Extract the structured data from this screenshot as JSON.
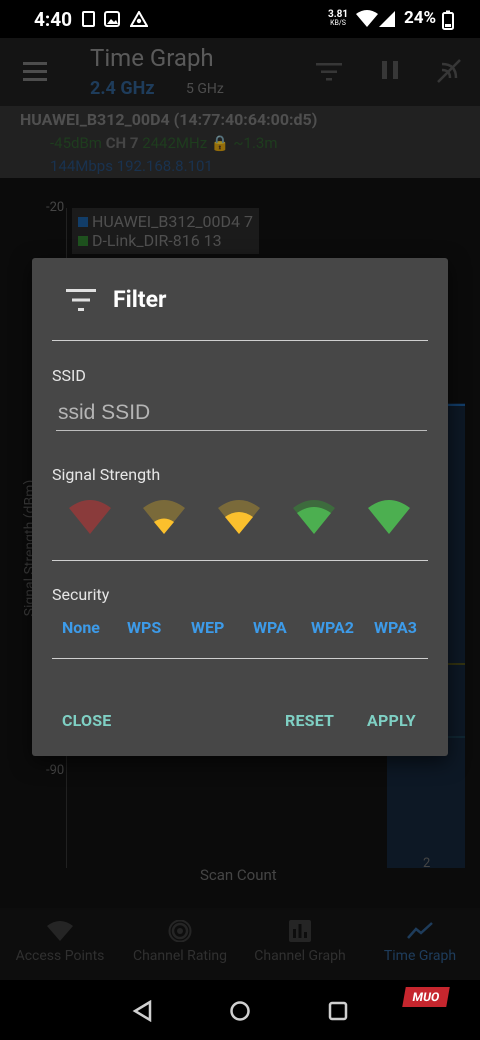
{
  "status_bar": {
    "time": "4:40",
    "net_speed_value": "3.81",
    "net_speed_unit": "KB/S",
    "battery": "24%"
  },
  "app_bar": {
    "title": "Time Graph",
    "band_selected": "2.4 GHz",
    "band_other": "5 GHz",
    "icons": [
      "menu-icon",
      "filter-icon",
      "pause-icon",
      "wifi-scan-icon"
    ]
  },
  "info_row": {
    "ssid_line": "HUAWEI_B312_00D4 (14:77:40:64:00:d5)",
    "signal": "-45dBm",
    "channel_label": "CH",
    "channel": "7",
    "frequency": "2442MHz",
    "distance": "~1.3m",
    "speed_ip": "144Mbps 192.168.8.101"
  },
  "graph": {
    "y_top_tick": "-20",
    "y_bottom_tick": "-90",
    "y_label": "Signal Strength (dBm)",
    "x_label": "Scan Count",
    "x_tick": "2",
    "legend": [
      {
        "label": "HUAWEI_B312_00D4 7",
        "color": "#1d5fa0"
      },
      {
        "label": "D-Link_DIR-816 13",
        "color": "#2f7d2f"
      }
    ]
  },
  "dialog": {
    "title": "Filter",
    "ssid_label": "SSID",
    "ssid_placeholder": "ssid SSID",
    "signal_label": "Signal Strength",
    "signal_levels": [
      {
        "name": "signal-level-0",
        "color": "#e53935",
        "fill": 0
      },
      {
        "name": "signal-level-1",
        "color": "#fbc02d",
        "fill": 1
      },
      {
        "name": "signal-level-2",
        "color": "#fbc02d",
        "fill": 2
      },
      {
        "name": "signal-level-3",
        "color": "#4caf50",
        "fill": 3
      },
      {
        "name": "signal-level-4",
        "color": "#4caf50",
        "fill": 4
      }
    ],
    "security_label": "Security",
    "security_options": [
      "None",
      "WPS",
      "WEP",
      "WPA",
      "WPA2",
      "WPA3"
    ],
    "close": "CLOSE",
    "reset": "RESET",
    "apply": "APPLY"
  },
  "bottom_nav": {
    "items": [
      "Access Points",
      "Channel Rating",
      "Channel Graph",
      "Time Graph"
    ],
    "active": "Time Graph",
    "accent": "#2f5d8c"
  },
  "watermark": "MUO"
}
